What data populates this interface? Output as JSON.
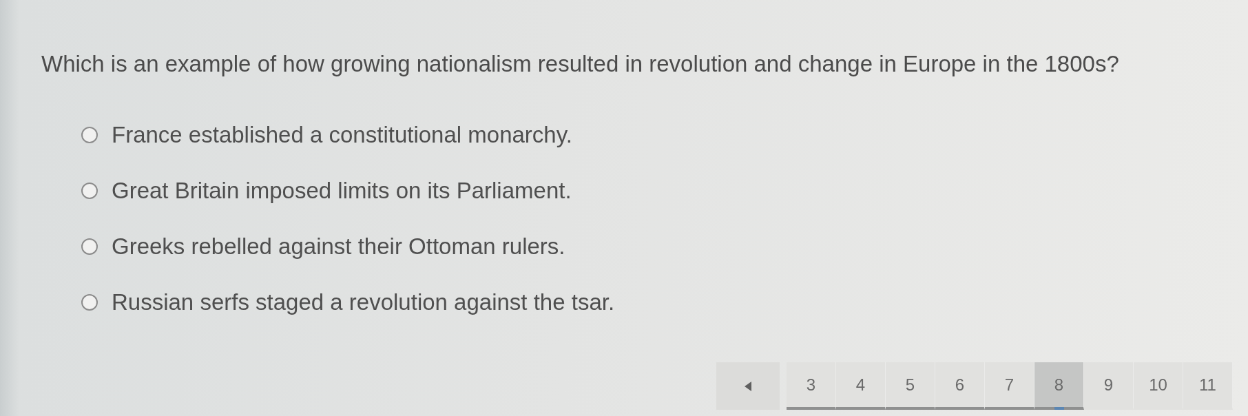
{
  "question": "Which is an example of how growing nationalism resulted in revolution and change in Europe in the 1800s?",
  "options": [
    {
      "text": "France established a constitutional monarchy.",
      "selected": false
    },
    {
      "text": "Great Britain imposed limits on its Parliament.",
      "selected": false
    },
    {
      "text": "Greeks rebelled against their Ottoman rulers.",
      "selected": false
    },
    {
      "text": "Russian serfs staged a revolution against the tsar.",
      "selected": false
    }
  ],
  "pagination": {
    "pages": [
      {
        "label": "3",
        "selected": false,
        "visited": true
      },
      {
        "label": "4",
        "selected": false,
        "visited": true
      },
      {
        "label": "5",
        "selected": false,
        "visited": true
      },
      {
        "label": "6",
        "selected": false,
        "visited": true
      },
      {
        "label": "7",
        "selected": false,
        "visited": true
      },
      {
        "label": "8",
        "selected": true,
        "visited": true
      },
      {
        "label": "9",
        "selected": false,
        "visited": false
      },
      {
        "label": "10",
        "selected": false,
        "visited": false
      },
      {
        "label": "11",
        "selected": false,
        "visited": false
      }
    ]
  }
}
